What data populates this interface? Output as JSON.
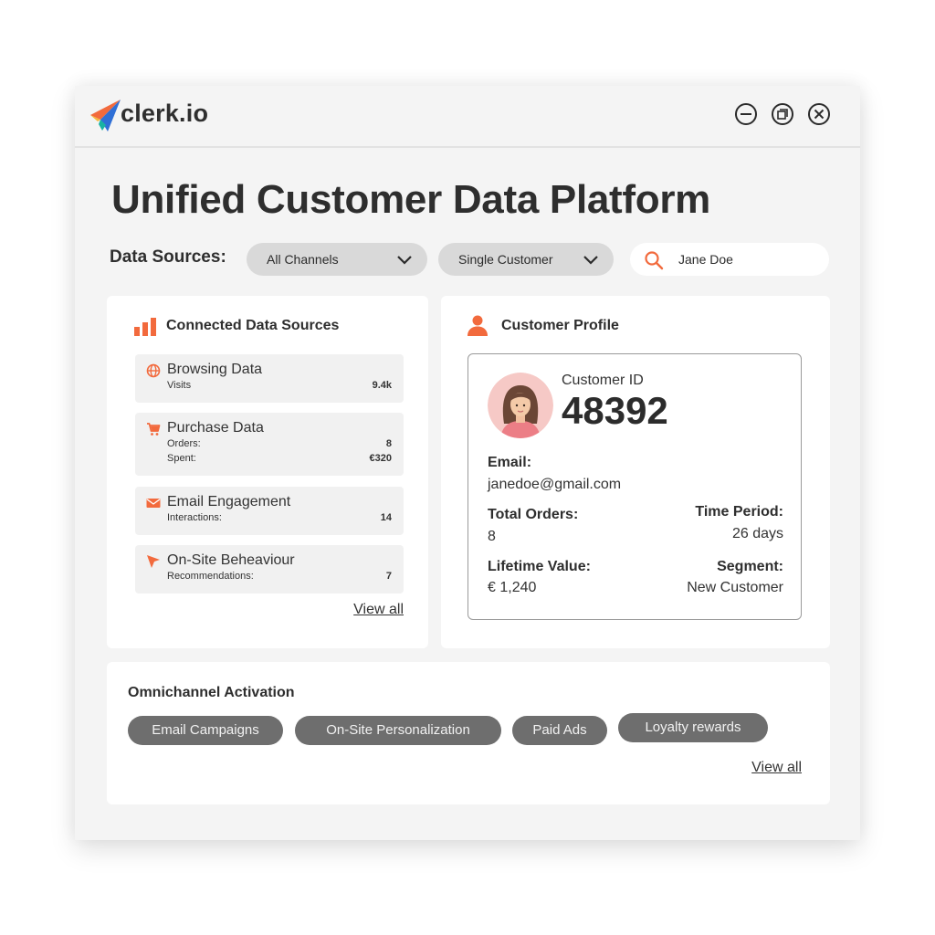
{
  "app": {
    "brand": "clerk.io",
    "window_controls": {
      "minimize": "minimize-icon",
      "restore": "restore-icon",
      "close": "close-icon"
    }
  },
  "page": {
    "title": "Unified Customer Data Platform"
  },
  "filters": {
    "label": "Data Sources:",
    "channel": "All Channels",
    "scope": "Single Customer",
    "search_value": "Jane Doe"
  },
  "sources": {
    "title": "Connected Data Sources",
    "items": [
      {
        "icon": "globe-icon",
        "name": "Browsing Data",
        "rows": [
          {
            "k": "Visits",
            "v": "9.4k"
          }
        ]
      },
      {
        "icon": "cart-icon",
        "name": "Purchase Data",
        "rows": [
          {
            "k": "Orders:",
            "v": "8"
          },
          {
            "k": "Spent:",
            "v": "€320"
          }
        ]
      },
      {
        "icon": "mail-icon",
        "name": "Email Engagement",
        "rows": [
          {
            "k": "Interactions:",
            "v": "14"
          }
        ]
      },
      {
        "icon": "cursor-icon",
        "name": "On-Site Beheaviour",
        "rows": [
          {
            "k": "Recommendations:",
            "v": "7"
          }
        ]
      }
    ],
    "view_all": "View all"
  },
  "profile": {
    "title": "Customer Profile",
    "id_label": "Customer ID",
    "id_value": "48392",
    "email_label": "Email:",
    "email_value": "janedoe@gmail.com",
    "orders_label": "Total Orders:",
    "orders_value": "8",
    "period_label": "Time Period:",
    "period_value": "26 days",
    "ltv_label": "Lifetime Value:",
    "ltv_value": "€ 1,240",
    "segment_label": "Segment:",
    "segment_value": "New Customer"
  },
  "activation": {
    "title": "Omnichannel Activation",
    "channels": [
      "Email Campaigns",
      "On-Site Personalization",
      "Paid Ads",
      "Loyalty rewards"
    ],
    "view_all": "View all"
  },
  "colors": {
    "accent": "#f26a3d",
    "chip": "#6e6e6e",
    "window": "#f4f4f4"
  }
}
